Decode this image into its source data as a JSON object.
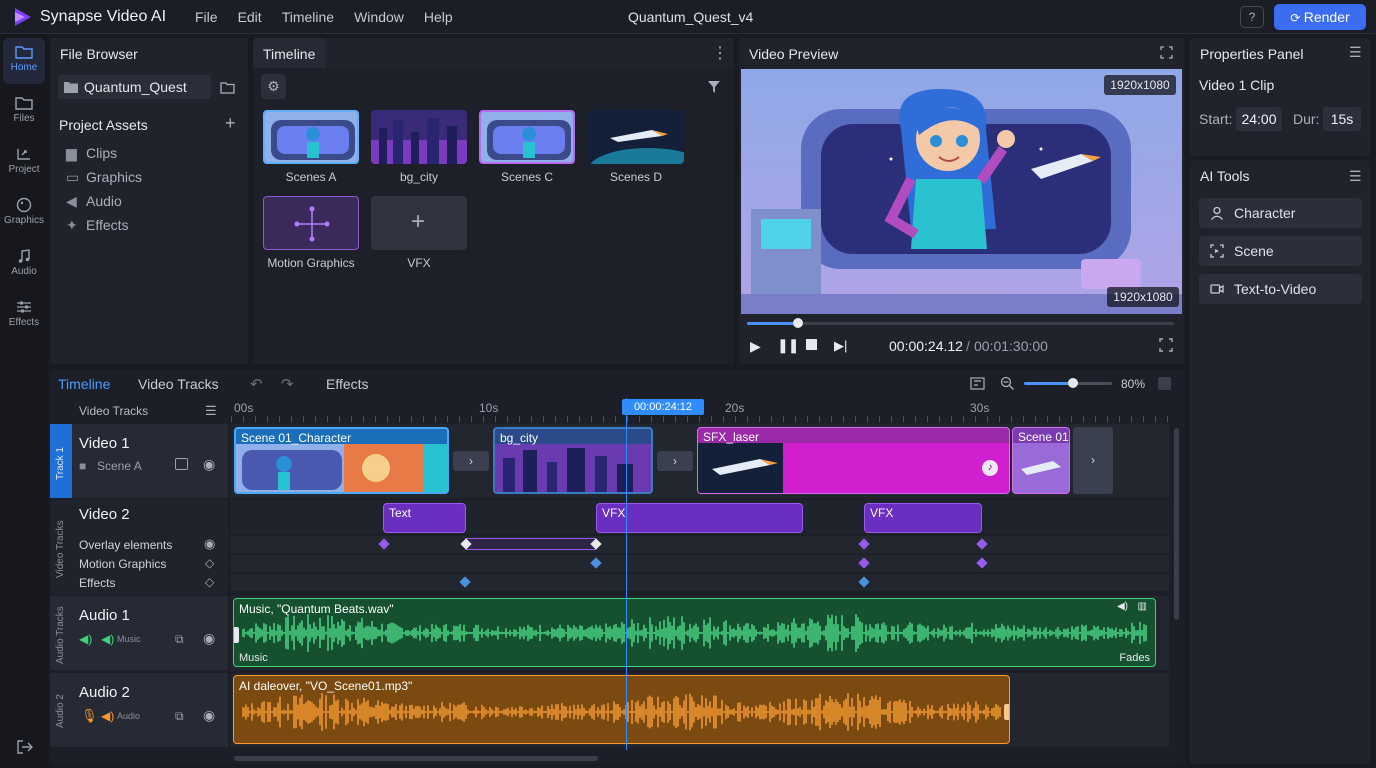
{
  "app": {
    "name": "Synapse Video AI",
    "document_title": "Quantum_Quest_v4",
    "render_label": "Render",
    "help_label": "?"
  },
  "menu": [
    "File",
    "Edit",
    "Timeline",
    "Window",
    "Help"
  ],
  "rail": [
    {
      "label": "Home",
      "icon": "folder-icon",
      "active": true
    },
    {
      "label": "Files",
      "icon": "folder-icon"
    },
    {
      "label": "Project",
      "icon": "project-icon"
    },
    {
      "label": "Graphics",
      "icon": "palette-icon"
    },
    {
      "label": "Audio",
      "icon": "music-note-icon"
    },
    {
      "label": "Effects",
      "icon": "sliders-icon"
    }
  ],
  "file_browser": {
    "title": "File Browser",
    "folder": "Quantum_Quest",
    "assets_title": "Project Assets",
    "tree": [
      "Clips",
      "Graphics",
      "Audio",
      "Effects"
    ]
  },
  "timeline_panel": {
    "title": "Timeline",
    "thumbs": [
      {
        "label": "Scenes A"
      },
      {
        "label": "bg_city"
      },
      {
        "label": "Scenes C"
      },
      {
        "label": "Scenes D"
      },
      {
        "label": "Motion Graphics"
      },
      {
        "label": "VFX"
      }
    ]
  },
  "preview": {
    "title": "Video Preview",
    "resolution_top": "1920x1080",
    "resolution_bottom": "1920x1080",
    "current_time": "00:00:24.12",
    "separator": "/",
    "total_time": "00:01:30:00",
    "progress": 0.12
  },
  "properties": {
    "title": "Properties Panel",
    "clip_name": "Video 1 Clip",
    "start_label": "Start:",
    "start_value": "24:00",
    "dur_label": "Dur:",
    "dur_value": "15s"
  },
  "ai_tools": {
    "title": "AI Tools",
    "items": [
      {
        "label": "Character",
        "icon": "person-icon"
      },
      {
        "label": "Scene",
        "icon": "scene-frame-icon"
      },
      {
        "label": "Text-to-Video",
        "icon": "video-camera-icon"
      }
    ]
  },
  "editor": {
    "tabs": [
      "Timeline",
      "Video Tracks",
      "Effects"
    ],
    "zoom_label": "80%",
    "zoom_level": 0.56,
    "ruler": [
      "00s",
      "10s",
      "20s",
      "30s"
    ],
    "playhead_time": "00:00:24:12",
    "video_tracks_header": "Video Tracks",
    "tracks": {
      "video1": {
        "name": "Video 1",
        "sub": "Scene A",
        "side": "Track 1"
      },
      "video2": {
        "name": "Video 2",
        "side": "Video Tracks"
      },
      "overlay": [
        "Overlay elements",
        "Motion Graphics",
        "Effects"
      ],
      "audio1": {
        "name": "Audio 1",
        "sub": "Music",
        "side": "Audio Tracks"
      },
      "audio2": {
        "name": "Audio 2",
        "sub": "Audio",
        "side": "Audio 2"
      }
    },
    "clips_v1": [
      "Scene 01_Character",
      "bg_city",
      "SFX_laser",
      "Scene 01"
    ],
    "clips_v2": [
      "Text",
      "VFX",
      "VFX"
    ],
    "audio1_clip": {
      "title": "Music, \"Quantum Beats.wav\"",
      "left_tag": "Music",
      "right_tag": "Fades"
    },
    "audio2_clip": {
      "title": "AI daleover, \"VO_Scene01.mp3\""
    }
  },
  "colors": {
    "accent": "#3c6df0",
    "playhead": "#2f8cff",
    "purple": "#8a3fd6",
    "audio_green": "#1e7a46",
    "audio_orange": "#9a5a12",
    "magenta": "#d11fd0"
  }
}
